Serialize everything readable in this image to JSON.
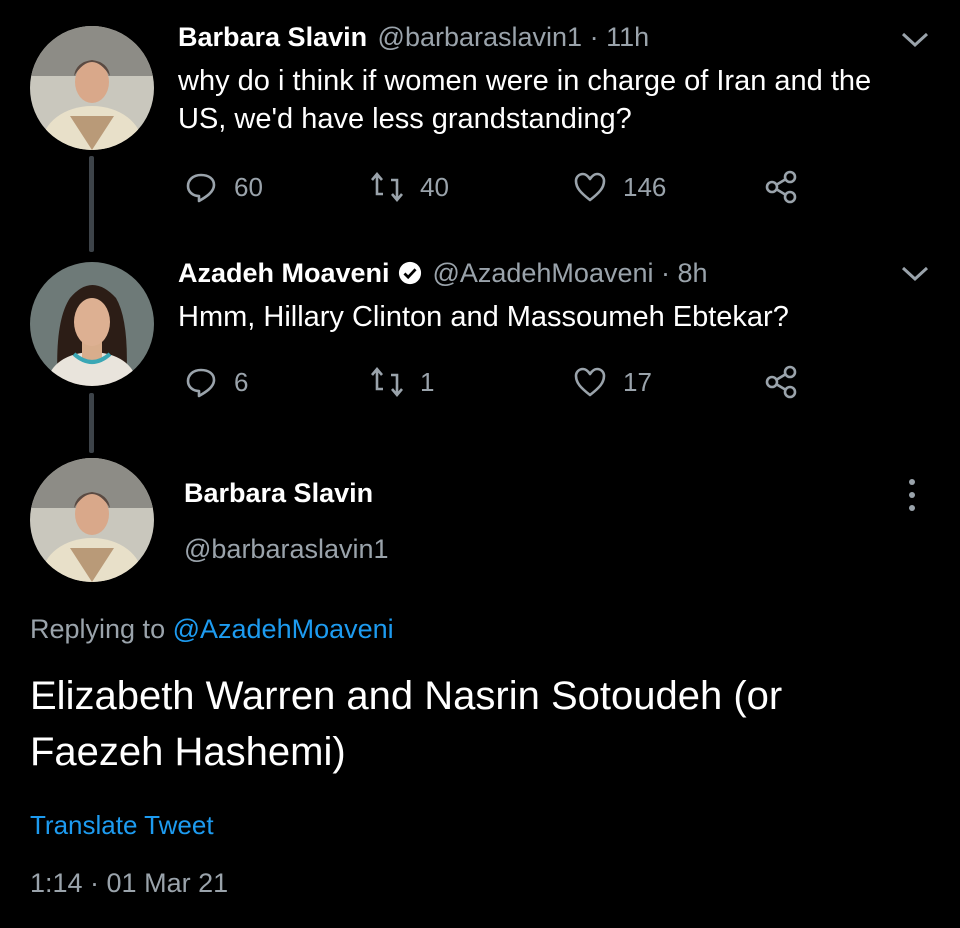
{
  "tweets": [
    {
      "name": "Barbara Slavin",
      "handle": "@barbaraslavin1",
      "time": "11h",
      "text_lines": [
        "why do i think if women were in charge of Iran and the",
        "US, we'd have less grandstanding?"
      ],
      "replies": "60",
      "retweets": "40",
      "likes": "146"
    },
    {
      "name": "Azadeh Moaveni",
      "handle": "@AzadehMoaveni",
      "time": "8h",
      "verified": true,
      "text_lines": [
        "Hmm, Hillary Clinton and Massoumeh Ebtekar?"
      ],
      "replies": "6",
      "retweets": "1",
      "likes": "17"
    }
  ],
  "main": {
    "name": "Barbara Slavin",
    "handle": "@barbaraslavin1",
    "replying_prefix": "Replying to",
    "replying_handle": "@AzadehMoaveni",
    "text_lines": [
      "Elizabeth Warren and Nasrin Sotoudeh (or",
      "Faezeh Hashemi)"
    ],
    "translate": "Translate Tweet",
    "timestamp": "1:14 · 01 Mar 21"
  },
  "separator": " · ",
  "icons": [
    "reply-icon",
    "retweet-icon",
    "like-icon",
    "share-icon",
    "chevron-down-icon",
    "more-vertical-icon",
    "verified-icon"
  ],
  "colors": {
    "background": "#000000",
    "secondary_text": "#9aa3ab",
    "link": "#1d9bf0",
    "thread_line": "#3d4349"
  }
}
